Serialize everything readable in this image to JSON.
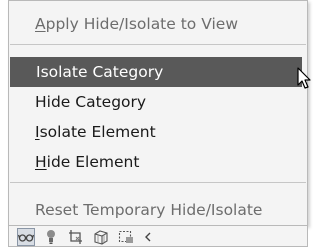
{
  "menu": {
    "items": [
      {
        "pre": "",
        "mn": "A",
        "post": "pply Hide/Isolate to View"
      },
      {
        "pre": "Isolate Category",
        "mn": "",
        "post": ""
      },
      {
        "pre": "Hide Category",
        "mn": "",
        "post": ""
      },
      {
        "pre": "",
        "mn": "I",
        "post": "solate Element"
      },
      {
        "pre": "",
        "mn": "H",
        "post": "ide Element"
      },
      {
        "pre": "Reset Temporary Hide/Isolate",
        "mn": "",
        "post": ""
      }
    ]
  },
  "toolbar": {
    "icons": [
      "glasses-icon",
      "lightbulb-icon",
      "crop-view-icon",
      "3d-section-box-icon",
      "temporary-hide-icon",
      "chevron-left-icon"
    ]
  },
  "colors": {
    "menu_bg": "#f4f4f4",
    "highlight": "#595959",
    "disabled_text": "#6d6d6d"
  }
}
